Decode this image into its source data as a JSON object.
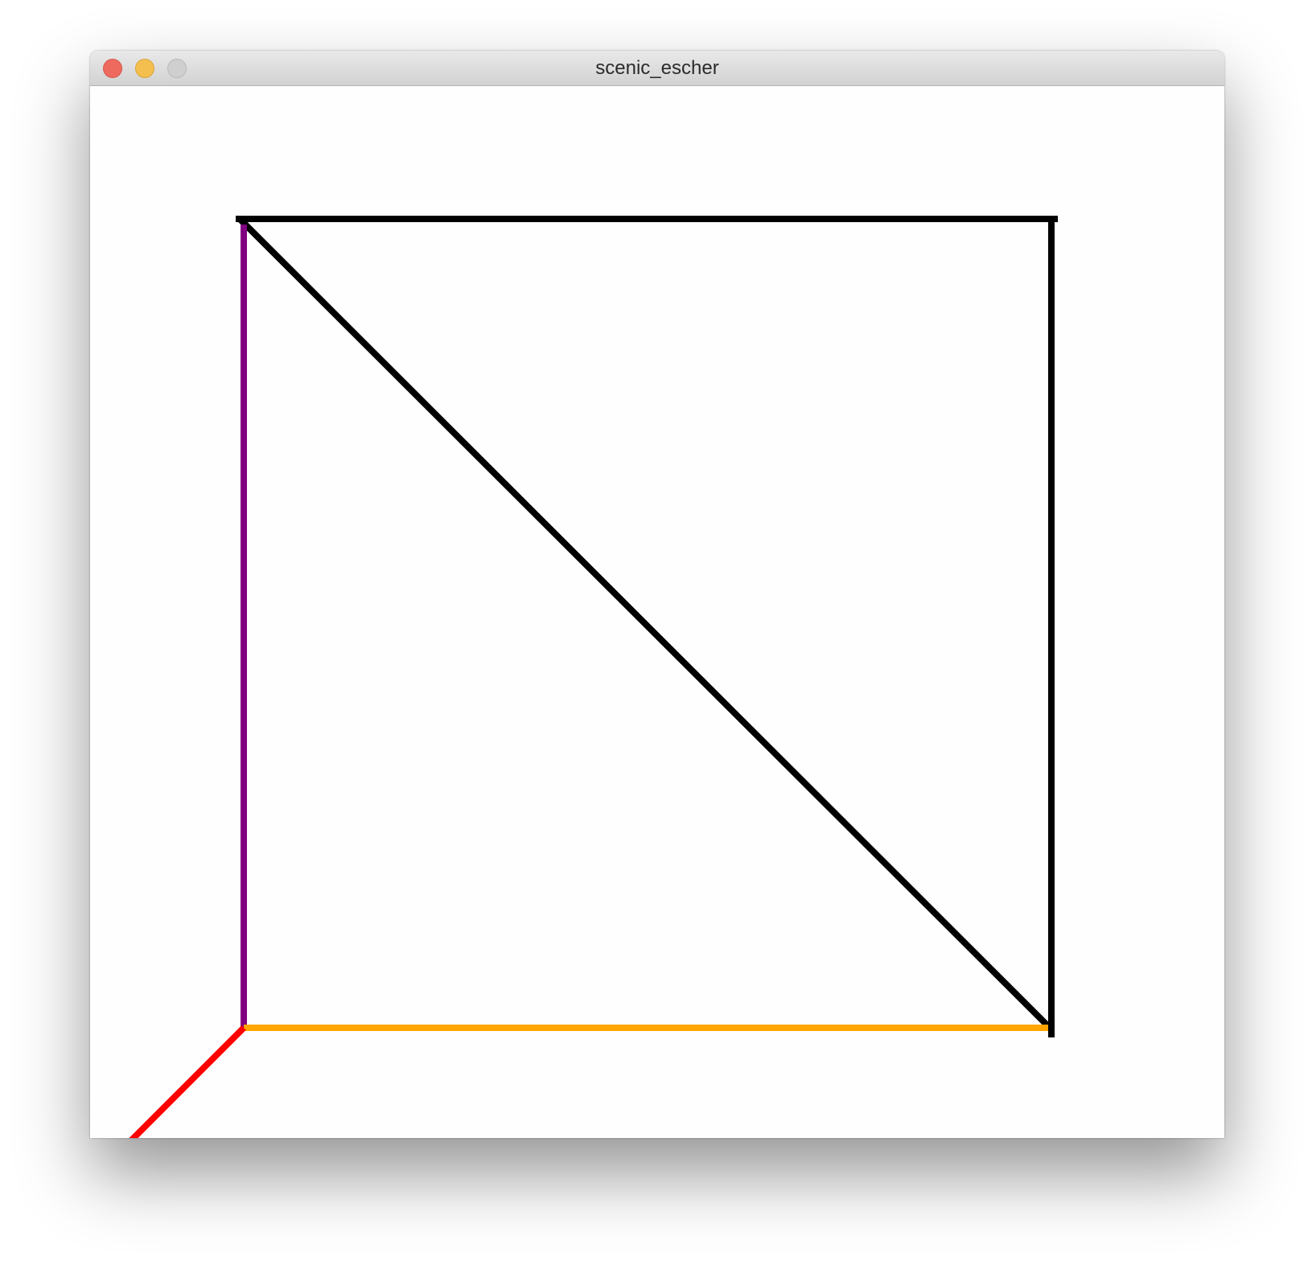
{
  "window": {
    "title": "scenic_escher"
  },
  "traffic_lights": {
    "close_color": "#ee6a5f",
    "minimize_color": "#f5bf4f",
    "zoom_color": "#cfcfcf"
  },
  "canvas": {
    "background": "#fefefe",
    "lines": [
      {
        "name": "line-top",
        "color": "#000000"
      },
      {
        "name": "line-right",
        "color": "#000000"
      },
      {
        "name": "line-diagonal",
        "color": "#000000"
      },
      {
        "name": "line-left",
        "color": "#800080"
      },
      {
        "name": "line-bottom",
        "color": "#ffa500"
      },
      {
        "name": "line-red-stub",
        "color": "#ff0000"
      }
    ]
  }
}
